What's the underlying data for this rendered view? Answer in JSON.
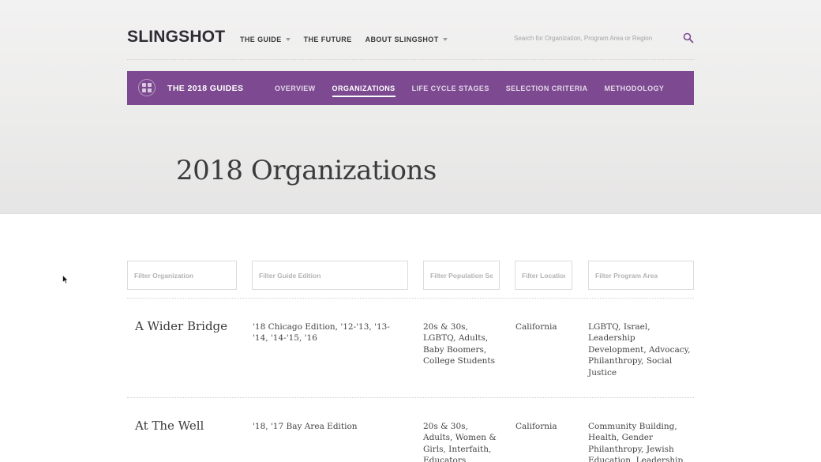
{
  "brand": {
    "logo": "SLINGSHOT"
  },
  "top_nav": [
    {
      "label": "THE GUIDE",
      "dropdown": true
    },
    {
      "label": "THE FUTURE",
      "dropdown": false
    },
    {
      "label": "ABOUT SLINGSHOT",
      "dropdown": true
    }
  ],
  "search": {
    "placeholder": "Search for Organization, Program Area or Region"
  },
  "guides_bar": {
    "title": "THE 2018 GUIDES",
    "tabs": [
      {
        "label": "OVERVIEW",
        "active": false
      },
      {
        "label": "ORGANIZATIONS",
        "active": true
      },
      {
        "label": "LIFE CYCLE STAGES",
        "active": false
      },
      {
        "label": "SELECTION CRITERIA",
        "active": false
      },
      {
        "label": "METHODOLOGY",
        "active": false
      }
    ]
  },
  "page": {
    "title": "2018 Organizations"
  },
  "filters": {
    "organization": "Filter Organization",
    "guide_edition": "Filter Guide Edition",
    "population": "Filter Population Served",
    "location": "Filter Location",
    "program_area": "Filter Program Area"
  },
  "organizations": [
    {
      "name": "A Wider Bridge",
      "edition": "'18 Chicago Edition, '12-'13, '13-'14, '14-'15, '16",
      "population": "20s & 30s, LGBTQ, Adults, Baby Boomers, College Students",
      "location": "California",
      "program_area": "LGBTQ, Israel, Leadership Development, Advocacy, Philanthropy, Social Justice"
    },
    {
      "name": "At The Well",
      "edition": "'18, '17 Bay Area Edition",
      "population": "20s & 30s, Adults, Women & Girls, Interfaith, Educators, College",
      "location": "California",
      "program_area": "Community Building, Health, Gender Philanthropy, Jewish Education, Leadership"
    }
  ],
  "colors": {
    "accent": "#7d4a91",
    "search_icon": "#7d4a91"
  }
}
